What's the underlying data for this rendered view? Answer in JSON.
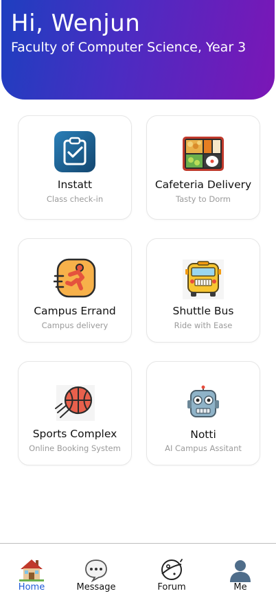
{
  "header": {
    "greeting": "Hi, Wenjun",
    "faculty": "Faculty of Computer Science, Year 3",
    "gradient_start": "#1d3fc0",
    "gradient_end": "#7b16b6"
  },
  "cards": [
    {
      "title": "Instatt",
      "subtitle": "Class check-in",
      "icon": "clipboard-check-icon"
    },
    {
      "title": "Cafeteria Delivery",
      "subtitle": "Tasty to Dorm",
      "icon": "bento-box-icon"
    },
    {
      "title": "Campus Errand",
      "subtitle": "Campus delivery",
      "icon": "running-person-icon"
    },
    {
      "title": "Shuttle Bus",
      "subtitle": "Ride with Ease",
      "icon": "bus-icon"
    },
    {
      "title": "Sports Complex",
      "subtitle": "Online Booking System",
      "icon": "basketball-icon"
    },
    {
      "title": "Notti",
      "subtitle": "AI Campus Assitant",
      "icon": "robot-icon"
    }
  ],
  "nav": {
    "items": [
      {
        "label": "Home",
        "icon": "house-icon",
        "active": true
      },
      {
        "label": "Message",
        "icon": "chat-bubble-icon",
        "active": false
      },
      {
        "label": "Forum",
        "icon": "planet-icon",
        "active": false
      },
      {
        "label": "Me",
        "icon": "person-icon",
        "active": false
      }
    ],
    "active_color": "#1e5ad7"
  }
}
